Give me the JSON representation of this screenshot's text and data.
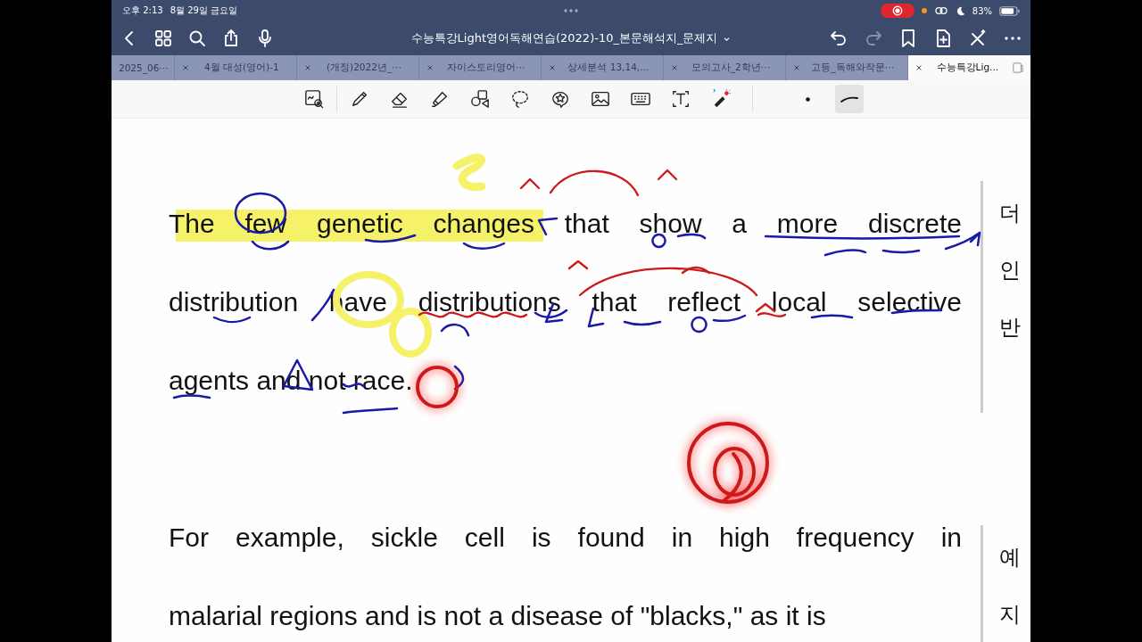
{
  "status_bar": {
    "time": "오후 2:13",
    "date": "8월 29일 금요일",
    "recording": true,
    "battery": "83%"
  },
  "title_bar": {
    "title": "수능특강Light영어독해연습(2022)-10_본문해석지_문제지",
    "right_buttons": [
      {
        "disabled": false
      },
      {
        "disabled": true
      },
      {
        "disabled": false
      },
      {
        "disabled": false
      },
      {
        "disabled": false
      },
      {
        "disabled": false
      }
    ]
  },
  "tabs": [
    {
      "label": "2025_06⋯",
      "selected": false
    },
    {
      "label": "4월 대성(영어)-1",
      "selected": false
    },
    {
      "label": "(개정)2022년_⋯",
      "selected": false
    },
    {
      "label": "자이스토리영어⋯",
      "selected": false
    },
    {
      "label": "상세분석 13,14,...",
      "selected": false
    },
    {
      "label": "모의고사_2학년⋯",
      "selected": false
    },
    {
      "label": "고등_독해와작문⋯",
      "selected": false
    },
    {
      "label": "수능특강Lig...",
      "selected": true
    }
  ],
  "toolbar": {
    "tools": [
      {
        "selected": false
      },
      {
        "selected": false
      },
      {
        "selected": false
      },
      {
        "selected": false
      },
      {
        "selected": false
      },
      {
        "selected": false
      },
      {
        "selected": false
      },
      {
        "selected": false
      },
      {
        "selected": false
      },
      {
        "selected": false
      },
      {
        "selected": false
      }
    ],
    "options": [
      {
        "selected": false
      },
      {
        "selected": true
      }
    ]
  },
  "document": {
    "paragraphs": [
      {
        "lines": [
          "The few genetic changes that show a more discrete",
          "distribution have distributions that reflect local selective",
          "agents and not race."
        ]
      },
      {
        "lines": [
          "For example, sickle cell is found in high frequency in",
          "malarial regions and is not a disease of \"blacks,\" as it is"
        ]
      }
    ],
    "side_column": [
      {
        "lines": [
          "더",
          "인",
          "반"
        ]
      },
      {
        "lines": [
          "예",
          "지"
        ]
      }
    ]
  }
}
